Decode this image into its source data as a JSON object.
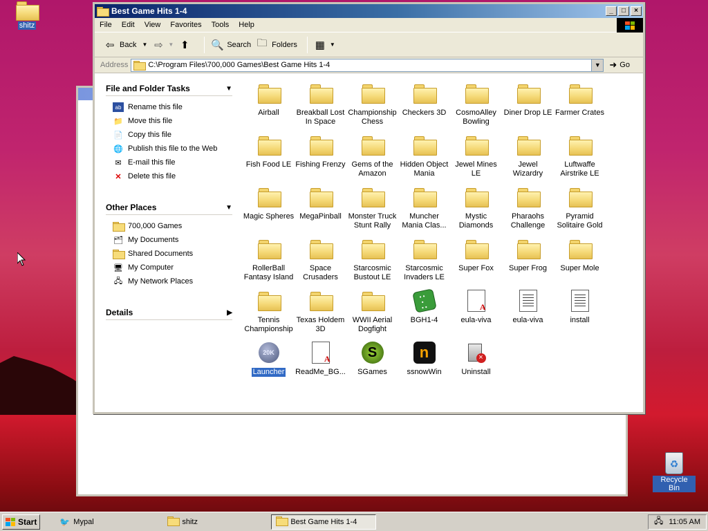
{
  "desktop": {
    "icons": [
      {
        "label": "shitz"
      }
    ],
    "recycle_bin": {
      "label": "Recycle Bin"
    }
  },
  "window": {
    "title": "Best Game Hits 1-4",
    "menu": [
      "File",
      "Edit",
      "View",
      "Favorites",
      "Tools",
      "Help"
    ],
    "toolbar": {
      "back": "Back",
      "search": "Search",
      "folders": "Folders"
    },
    "address": {
      "label": "Address",
      "value": "C:\\Program Files\\700,000 Games\\Best Game Hits 1-4",
      "go": "Go"
    },
    "tasks": {
      "file_folder_tasks": {
        "title": "File and Folder Tasks",
        "items": [
          {
            "label": "Rename this file",
            "icon": "rename-icon"
          },
          {
            "label": "Move this file",
            "icon": "move-icon"
          },
          {
            "label": "Copy this file",
            "icon": "copy-icon"
          },
          {
            "label": "Publish this file to the Web",
            "icon": "web-publish-icon"
          },
          {
            "label": "E-mail this file",
            "icon": "email-icon"
          },
          {
            "label": "Delete this file",
            "icon": "delete-icon"
          }
        ]
      },
      "other_places": {
        "title": "Other Places",
        "items": [
          {
            "label": "700,000 Games",
            "icon": "folder-icon"
          },
          {
            "label": "My Documents",
            "icon": "my-documents-icon"
          },
          {
            "label": "Shared Documents",
            "icon": "folder-icon"
          },
          {
            "label": "My Computer",
            "icon": "computer-icon"
          },
          {
            "label": "My Network Places",
            "icon": "network-icon"
          }
        ]
      },
      "details": {
        "title": "Details"
      }
    },
    "files": [
      {
        "name": "Airball",
        "type": "folder"
      },
      {
        "name": "Breakball Lost In Space",
        "type": "folder"
      },
      {
        "name": "Championship Chess",
        "type": "folder"
      },
      {
        "name": "Checkers 3D",
        "type": "folder"
      },
      {
        "name": "CosmoAlley Bowling",
        "type": "folder"
      },
      {
        "name": "Diner Drop LE",
        "type": "folder"
      },
      {
        "name": "Farmer Crates",
        "type": "folder"
      },
      {
        "name": "Fish Food LE",
        "type": "folder"
      },
      {
        "name": "Fishing Frenzy",
        "type": "folder"
      },
      {
        "name": "Gems of the Amazon",
        "type": "folder"
      },
      {
        "name": "Hidden Object Mania",
        "type": "folder"
      },
      {
        "name": "Jewel Mines LE",
        "type": "folder"
      },
      {
        "name": "Jewel Wizardry",
        "type": "folder"
      },
      {
        "name": "Luftwaffe Airstrike LE",
        "type": "folder"
      },
      {
        "name": "Magic Spheres",
        "type": "folder"
      },
      {
        "name": "MegaPinball",
        "type": "folder"
      },
      {
        "name": "Monster Truck Stunt Rally",
        "type": "folder"
      },
      {
        "name": "Muncher Mania Clas...",
        "type": "folder"
      },
      {
        "name": "Mystic Diamonds",
        "type": "folder"
      },
      {
        "name": "Pharaohs Challenge",
        "type": "folder"
      },
      {
        "name": "Pyramid Solitaire Gold",
        "type": "folder"
      },
      {
        "name": "RollerBall Fantasy Island",
        "type": "folder"
      },
      {
        "name": "Space Crusaders",
        "type": "folder"
      },
      {
        "name": "Starcosmic Bustout LE",
        "type": "folder"
      },
      {
        "name": "Starcosmic Invaders LE",
        "type": "folder"
      },
      {
        "name": "Super Fox",
        "type": "folder"
      },
      {
        "name": "Super Frog",
        "type": "folder"
      },
      {
        "name": "Super Mole",
        "type": "folder"
      },
      {
        "name": "Tennis Championship",
        "type": "folder"
      },
      {
        "name": "Texas Holdem 3D",
        "type": "folder"
      },
      {
        "name": "WWII Aerial Dogfight",
        "type": "folder"
      },
      {
        "name": "BGH1-4",
        "type": "dice"
      },
      {
        "name": "eula-viva",
        "type": "readme"
      },
      {
        "name": "eula-viva",
        "type": "doc"
      },
      {
        "name": "install",
        "type": "doc"
      },
      {
        "name": "Launcher",
        "type": "launcher",
        "selected": true
      },
      {
        "name": "ReadMe_BG...",
        "type": "readme"
      },
      {
        "name": "SGames",
        "type": "sgames"
      },
      {
        "name": "ssnowWin",
        "type": "snow"
      },
      {
        "name": "Uninstall",
        "type": "uninstall"
      }
    ]
  },
  "taskbar": {
    "start": "Start",
    "buttons": [
      {
        "label": "Mypal",
        "active": false
      },
      {
        "label": "shitz",
        "active": false
      },
      {
        "label": "Best Game Hits 1-4",
        "active": true
      }
    ],
    "clock": "11:05 AM"
  }
}
